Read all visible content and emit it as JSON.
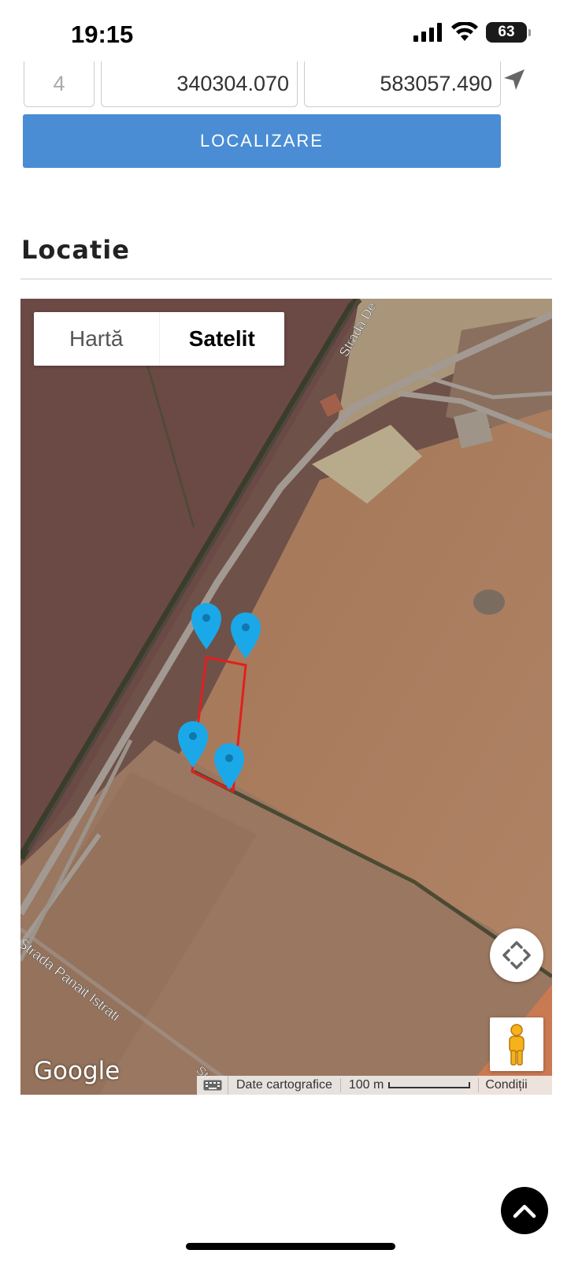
{
  "status_bar": {
    "time": "19:15",
    "battery": "63"
  },
  "coordinates": {
    "index": "4",
    "x": "340304.070",
    "y": "583057.490"
  },
  "localize_button": {
    "label": "LOCALIZARE"
  },
  "section": {
    "title": "Locatie"
  },
  "map": {
    "type_options": [
      "Hartă",
      "Satelit"
    ],
    "selected_type": "Satelit",
    "street_labels": [
      "Strada De",
      "Strada Panait Istrati",
      "Stra"
    ],
    "logo": "Google",
    "attribution": "Date cartografice",
    "scale_label": "100 m",
    "terms_label": "Condiții",
    "marker_color": "#1ba8e8",
    "parcel_color": "#e0201e"
  },
  "icons": [
    "signal-icon",
    "wifi-icon",
    "battery-icon",
    "navigation-arrow-icon",
    "fullscreen-icon",
    "pegman-icon",
    "keyboard-icon",
    "chevron-up-icon"
  ]
}
